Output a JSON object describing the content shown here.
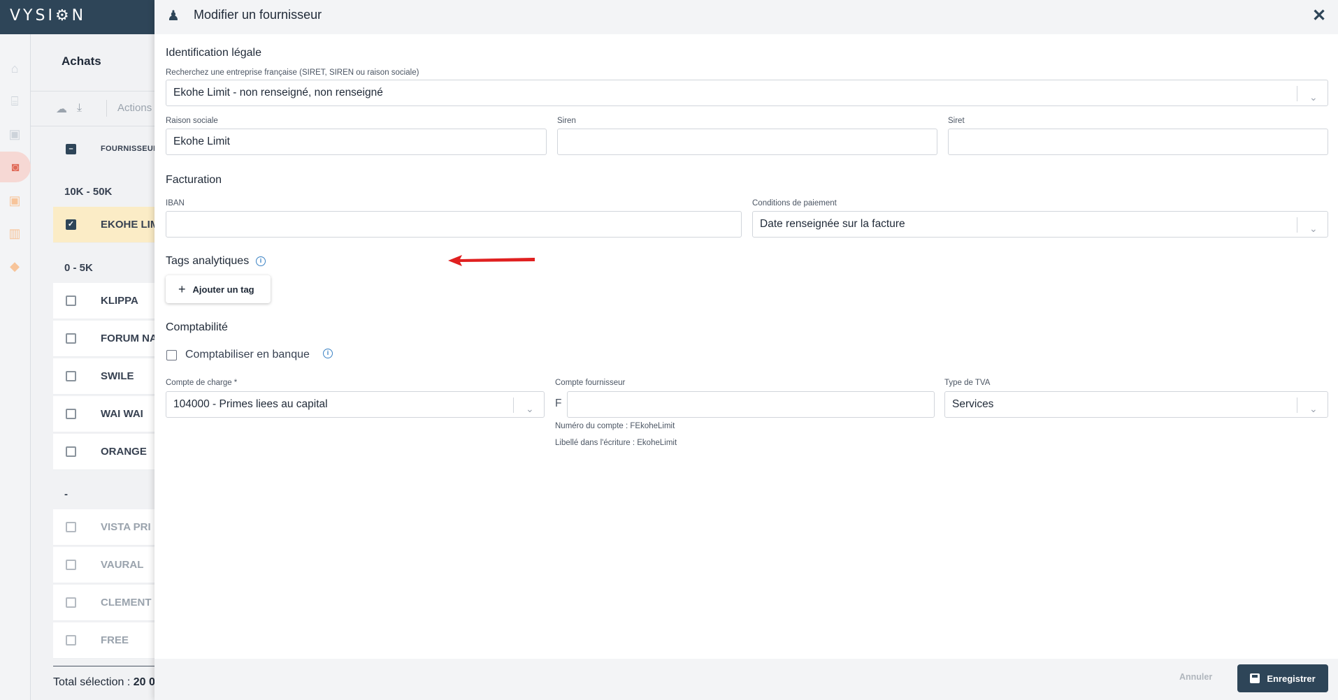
{
  "app": {
    "logo": "VYSI⚙N"
  },
  "background": {
    "page_title": "Achats",
    "toolbar": {
      "actions_label": "Actions"
    },
    "column_header": "FOURNISSEUR",
    "groups": [
      {
        "label": "10K - 50K",
        "rows": [
          {
            "name": "EKOHE LIM",
            "checked": true
          }
        ]
      },
      {
        "label": "0 - 5K",
        "rows": [
          {
            "name": "KLIPPA"
          },
          {
            "name": "FORUM NA"
          },
          {
            "name": "SWILE"
          },
          {
            "name": "WAI WAI"
          },
          {
            "name": "ORANGE"
          }
        ]
      },
      {
        "label": "-",
        "rows": [
          {
            "name": "VISTA PRI"
          },
          {
            "name": "VAURAL"
          },
          {
            "name": "CLEMENT"
          },
          {
            "name": "FREE"
          }
        ]
      }
    ],
    "total_label": "Total sélection :",
    "total_value": "20 0"
  },
  "drawer": {
    "title": "Modifier un fournisseur",
    "legal": {
      "section_title": "Identification légale",
      "search_label": "Recherchez une entreprise française (SIRET, SIREN ou raison sociale)",
      "search_value": "Ekohe Limit - non renseigné, non renseigné",
      "raison_label": "Raison sociale",
      "raison_value": "Ekohe Limit",
      "siren_label": "Siren",
      "siren_value": "",
      "siret_label": "Siret",
      "siret_value": ""
    },
    "billing": {
      "section_title": "Facturation",
      "iban_label": "IBAN",
      "iban_value": "",
      "terms_label": "Conditions de paiement",
      "terms_value": "Date renseignée sur la facture"
    },
    "tags": {
      "section_title": "Tags analytiques",
      "add_label": "Ajouter un tag"
    },
    "accounting": {
      "section_title": "Comptabilité",
      "bank_checkbox_label": "Comptabiliser en banque",
      "bank_checked": false,
      "charge_label": "Compte de charge *",
      "charge_value": "104000 - Primes liees au capital",
      "supplier_label": "Compte fournisseur",
      "supplier_prefix": "F",
      "supplier_value": "",
      "account_number_hint": "Numéro du compte : FEkoheLimit",
      "entry_label_hint": "Libellé dans l'écriture : EkoheLimit",
      "vat_label": "Type de TVA",
      "vat_value": "Services"
    },
    "footer": {
      "cancel_label": "Annuler",
      "save_label": "Enregistrer"
    }
  },
  "colors": {
    "brand": "#2e4558",
    "accent": "#e06a58",
    "selected_row": "#fbecc6",
    "annotation_arrow": "#e02020"
  },
  "icons": [
    "home-icon",
    "bank-icon",
    "invoice-icon",
    "purchases-icon",
    "sales-icon",
    "chart-icon",
    "tag-icon",
    "cloud-upload-icon",
    "download-icon",
    "supplier-icon",
    "close-icon",
    "info-icon",
    "plus-icon",
    "save-icon",
    "chevron-down-icon"
  ]
}
